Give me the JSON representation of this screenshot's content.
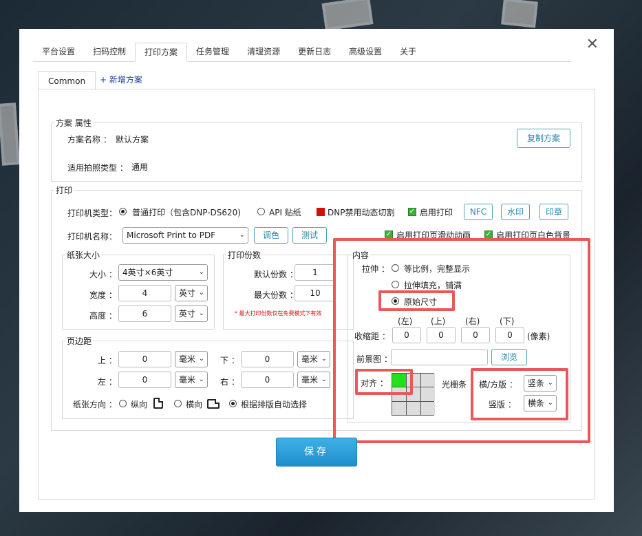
{
  "tabs": [
    "平台设置",
    "扫码控制",
    "打印方案",
    "任务管理",
    "清理资源",
    "更新日志",
    "高级设置",
    "关于"
  ],
  "subtabs": {
    "common": "Common",
    "add": "+ 新增方案"
  },
  "scheme": {
    "legend": "方案 属性",
    "name_label": "方案名称 ：",
    "name_value": "默认方案",
    "copy_button": "复制方案",
    "type_label": "适用拍照类型 ：",
    "type_value": "通用"
  },
  "print": {
    "legend": "打印",
    "printer_type_label": "打印机类型：",
    "opt_normal": "普通打印（包含DNP-DS620)",
    "opt_api": "API 贴纸",
    "dnp_label": "DNP禁用动态切割",
    "enable_print": "启用打印",
    "nfc": "NFC",
    "watermark": "水印",
    "stamp": "印章",
    "printer_name_label": "打印机名称：",
    "printer_name_value": "Microsoft Print to PDF",
    "color_btn": "调色",
    "test_btn": "测试",
    "enable_slide_anim": "启用打印页滑动动画",
    "enable_white_bg": "启用打印页白色背景"
  },
  "paper": {
    "legend": "纸张大小",
    "size_label": "大小 ：",
    "size_value": "4英寸×6英寸",
    "width_label": "宽度 ：",
    "width_value": "4",
    "height_label": "高度 ：",
    "height_value": "6",
    "unit": "英寸"
  },
  "copies": {
    "legend": "打印份数",
    "default_label": "默认份数 ：",
    "default_value": "1",
    "max_label": "最大份数 ：",
    "max_value": "10",
    "note": "* 最大打印份数仅在免费模式下有效"
  },
  "margin": {
    "legend": "页边距",
    "top_label": "上 ：",
    "top_value": "0",
    "bottom_label": "下 ：",
    "bottom_value": "0",
    "left_label": "左 ：",
    "left_value": "0",
    "right_label": "右 ：",
    "right_value": "0",
    "unit": "毫米",
    "orientation_label": "纸张方向 ：",
    "portrait": "纵向",
    "landscape": "横向",
    "auto": "根据排版自动选择"
  },
  "content": {
    "legend": "内容",
    "stretch_label": "拉伸 ：",
    "opt_ratio": "等比例，完整显示",
    "opt_fill": "拉伸填充，铺满",
    "opt_original": "原始尺寸",
    "pad_left": "(左)",
    "pad_top": "(上)",
    "pad_right": "(右)",
    "pad_bottom": "(下)",
    "shrink_label": "收缩距 ：",
    "shrink_values": [
      "0",
      "0",
      "0",
      "0"
    ],
    "pixel_unit": "(像素)",
    "foreground_label": "前景图 ：",
    "browse_btn": "浏览",
    "align_label": "对齐 ：",
    "raster_label": "光栅条",
    "landscape_label": "横/方版 ：",
    "landscape_value": "竖条",
    "portrait_label": "竖版 ：",
    "portrait_value": "横条"
  },
  "save_button": "保存",
  "colors": {
    "accent": "#2a86a8",
    "highlight": "#e85a5a",
    "save": "#1f8fcc",
    "align_on": "#22e01a"
  }
}
